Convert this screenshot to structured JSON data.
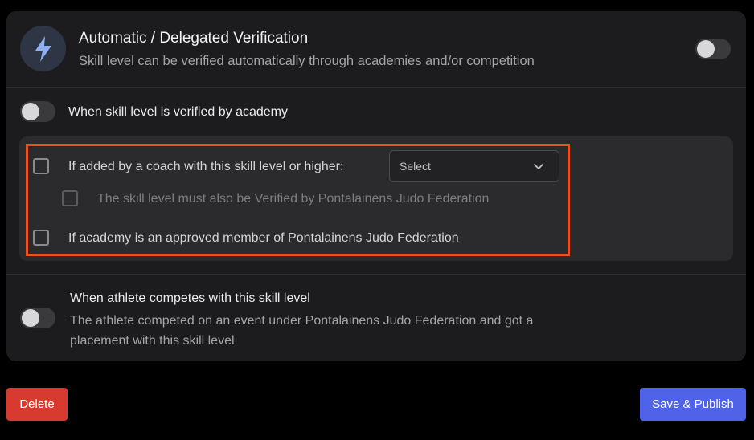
{
  "header": {
    "title": "Automatic / Delegated Verification",
    "subtitle": "Skill level can be verified automatically through academies and/or competition",
    "icon": "lightning-bolt",
    "toggle_on": false
  },
  "academy": {
    "label": "When skill level is verified by academy",
    "toggle_on": false,
    "options": {
      "coach_label": "If added by a coach with this skill level or higher:",
      "coach_checked": false,
      "select_value": "Select",
      "federation_verified_label": "The skill level must also be Verified by Pontalainens Judo Federation",
      "federation_verified_checked": false,
      "approved_member_label": "If academy is an approved member of Pontalainens Judo Federation",
      "approved_member_checked": false
    }
  },
  "competition": {
    "title": "When athlete competes with this skill level",
    "description": "The athlete competed on an event under Pontalainens Judo Federation and got a placement with this skill level",
    "toggle_on": false
  },
  "actions": {
    "delete_label": "Delete",
    "save_label": "Save & Publish"
  },
  "colors": {
    "background": "#000000",
    "card": "#1c1c1e",
    "panel": "#2b2b2e",
    "highlight": "#e8501f",
    "delete": "#d73a2f",
    "save": "#4f62e8",
    "bolt": "#8fb0f0"
  }
}
